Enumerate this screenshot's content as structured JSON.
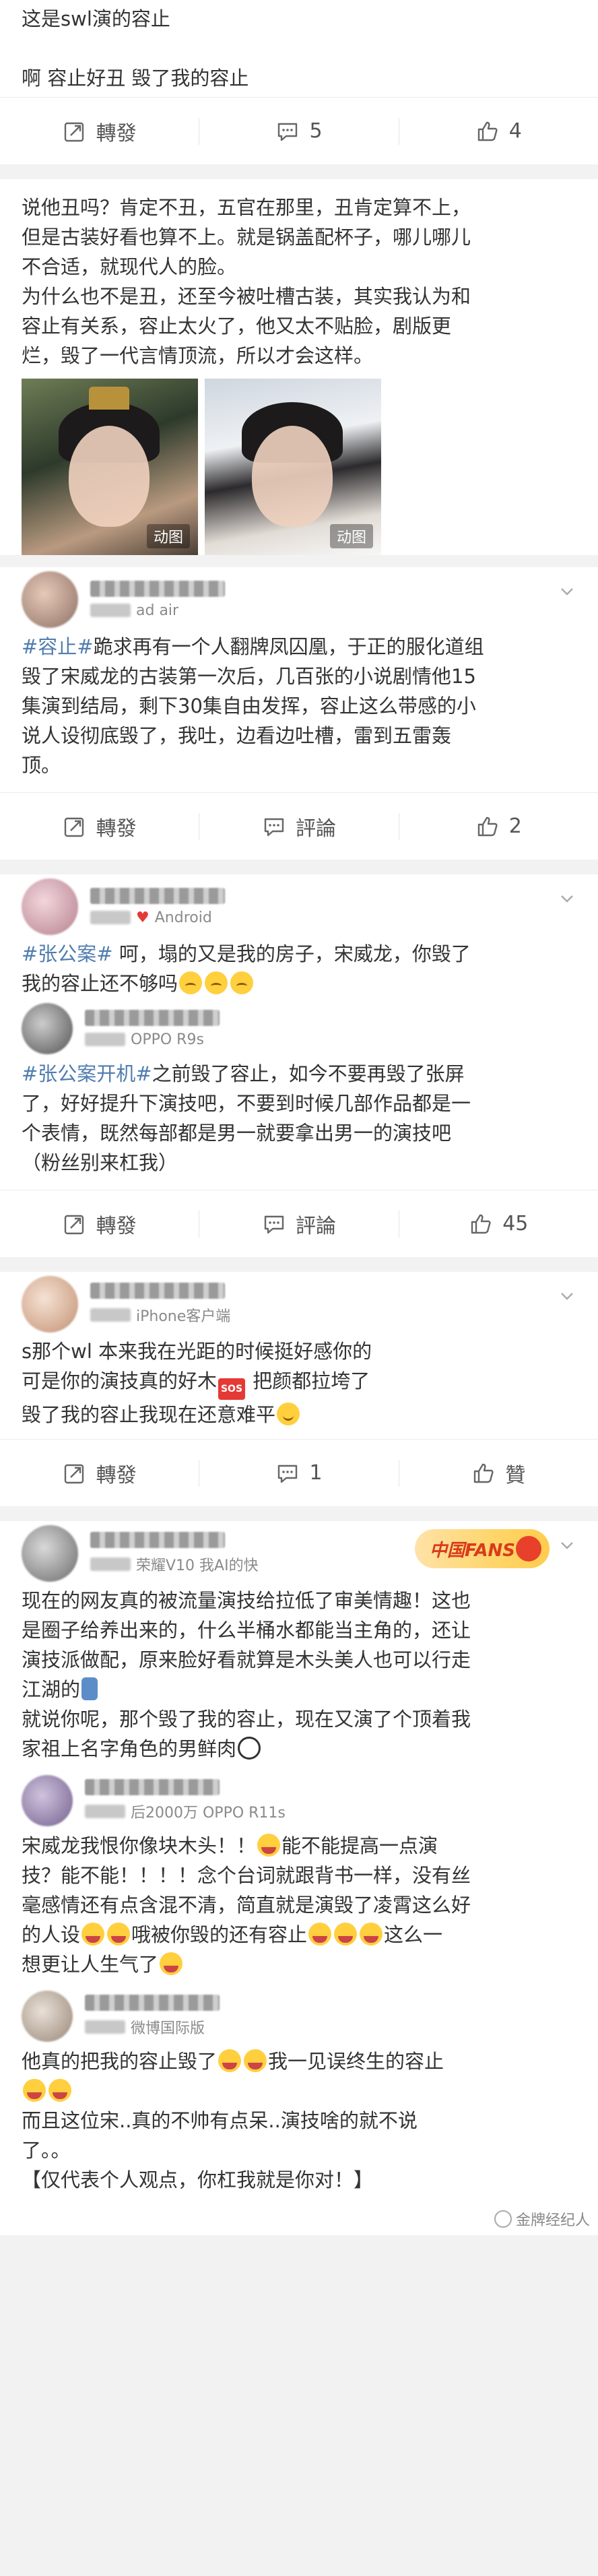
{
  "top_post": {
    "line1": "这是swl演的容止",
    "line2": "啊 容止好丑 毁了我的容止",
    "actions": {
      "repost": "轉發",
      "comment": "5",
      "like": "4"
    }
  },
  "post1": {
    "text": [
      "说他丑吗？肯定不丑，五官在那里，丑肯定算不上，",
      "但是古装好看也算不上。就是锅盖配杯子，哪儿哪儿",
      "不合适，就现代人的脸。",
      "为什么也不是丑，还至今被吐槽古装，其实我认为和",
      "容止有关系，容止太火了，他又太不贴脸，剧版更",
      "烂，毁了一代言情顶流，所以才会这样。"
    ],
    "images": [
      {
        "label": "动图"
      },
      {
        "label": "动图"
      }
    ]
  },
  "post2": {
    "source": "ad air",
    "tag": "#容止#",
    "text": [
      "跪求再有一个人翻牌凤囚凰，于正的服化道组",
      "毁了宋威龙的古装第一次后，几百张的小说剧情他15",
      "集演到结局，剩下30集自由发挥，容止这么带感的小",
      "说人设彻底毁了，我吐，边看边吐槽，雷到五雷轰",
      "顶。"
    ],
    "actions": {
      "repost": "轉發",
      "comment": "評論",
      "like": "2"
    }
  },
  "post3": {
    "source": "Android",
    "tag": "#张公案#",
    "text1": " 呵，塌的又是我的房子，宋威龙，你毁了",
    "text2": "我的容止还不够吗",
    "sub": {
      "source": "OPPO R9s",
      "tag": "#张公案开机#",
      "text": [
        "之前毁了容止，如今不要再毁了张屏",
        "了，好好提升下演技吧，不要到时候几部作品都是一",
        "个表情，既然每部都是男一就要拿出男一的演技吧",
        "（粉丝别来杠我）"
      ]
    },
    "actions": {
      "repost": "轉發",
      "comment": "評論",
      "like": "45"
    }
  },
  "post4": {
    "source": "iPhone客户端",
    "text": [
      "s那个wl  本来我在光距的时候挺好感你的",
      "可是你的演技真的好木",
      " 把颜都拉垮了",
      "毁了我的容止我现在还意难平"
    ],
    "sos": "SOS",
    "actions": {
      "repost": "轉發",
      "comment": "1",
      "like": "贊"
    }
  },
  "post5": {
    "source": "荣耀V10 我AI的快",
    "badge": "中国FANS",
    "text": [
      "现在的网友真的被流量演技给拉低了审美情趣！这也",
      "是圈子给养出来的，什么半桶水都能当主角的，还让",
      "演技派做配，原来脸好看就算是木头美人也可以行走",
      "江湖的",
      "就说你呢，那个毁了我的容止，现在又演了个顶着我",
      "家祖上名字角色的男鲜肉"
    ],
    "sub": {
      "source": "后2000万 OPPO R11s",
      "text": [
        "宋威龙我恨你像块木头！！",
        "能不能提高一点演",
        "技？能不能！！！！念个台词就跟背书一样，没有丝",
        "毫感情还有点含混不清，简直就是演毁了凌霄这么好",
        "的人设",
        "哦被你毁的还有容止",
        "这么一",
        "想更让人生气了"
      ]
    },
    "sub2": {
      "source": "微博国际版",
      "text": [
        "他真的把我的容止毁了",
        "我一见误终生的容止",
        "而且这位宋..真的不帅有点呆..演技啥的就不说",
        "了。。",
        "【仅代表个人观点，你杠我就是你对！】"
      ]
    }
  },
  "watermark": "金牌经纪人",
  "icons": [
    "repost-icon",
    "comment-icon",
    "like-icon",
    "chevron-down-icon"
  ]
}
